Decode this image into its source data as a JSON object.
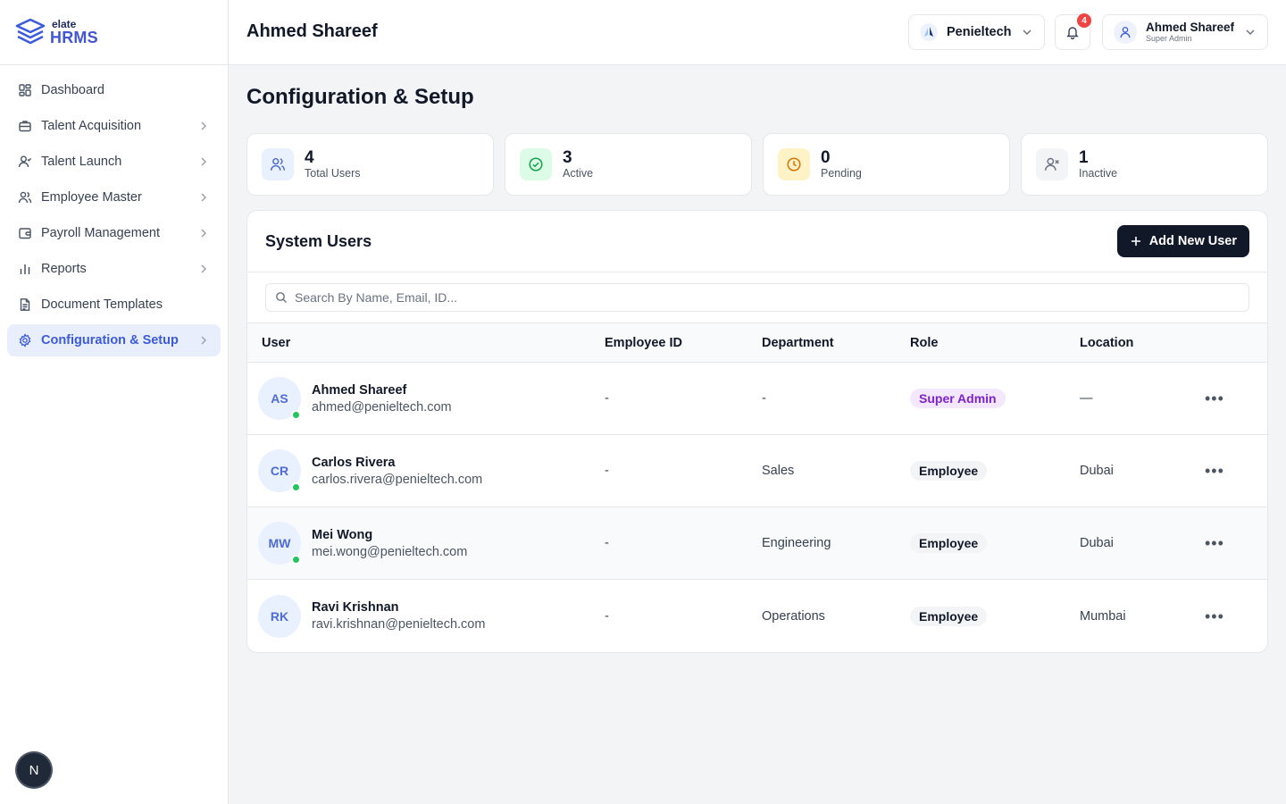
{
  "brand": {
    "small": "elate",
    "big": "HRMS"
  },
  "sidebar": {
    "items": [
      {
        "label": "Dashboard"
      },
      {
        "label": "Talent Acquisition"
      },
      {
        "label": "Talent Launch"
      },
      {
        "label": "Employee Master"
      },
      {
        "label": "Payroll Management"
      },
      {
        "label": "Reports"
      },
      {
        "label": "Document Templates"
      },
      {
        "label": "Configuration & Setup"
      }
    ],
    "bottom_badge": "N"
  },
  "header": {
    "title": "Ahmed Shareef",
    "org": "Penieltech",
    "notifications": "4",
    "user_name": "Ahmed Shareef",
    "user_role": "Super Admin"
  },
  "main": {
    "title": "Configuration & Setup",
    "stats": [
      {
        "value": "4",
        "label": "Total Users"
      },
      {
        "value": "3",
        "label": "Active"
      },
      {
        "value": "0",
        "label": "Pending"
      },
      {
        "value": "1",
        "label": "Inactive"
      }
    ],
    "card": {
      "title": "System Users",
      "add_button": "Add New User",
      "search_placeholder": "Search By Name, Email, ID..."
    },
    "table": {
      "headers": [
        "User",
        "Employee ID",
        "Department",
        "Role",
        "Location"
      ],
      "rows": [
        {
          "initials": "AS",
          "name": "Ahmed Shareef",
          "email": "ahmed@penieltech.com",
          "employee_id": "-",
          "department": "-",
          "role": "Super Admin",
          "location": "—"
        },
        {
          "initials": "CR",
          "name": "Carlos Rivera",
          "email": "carlos.rivera@penieltech.com",
          "employee_id": "-",
          "department": "Sales",
          "role": "Employee",
          "location": "Dubai"
        },
        {
          "initials": "MW",
          "name": "Mei Wong",
          "email": "mei.wong@penieltech.com",
          "employee_id": "-",
          "department": "Engineering",
          "role": "Employee",
          "location": "Dubai"
        },
        {
          "initials": "RK",
          "name": "Ravi Krishnan",
          "email": "ravi.krishnan@penieltech.com",
          "employee_id": "-",
          "department": "Operations",
          "role": "Employee",
          "location": "Mumbai"
        }
      ]
    }
  },
  "colors": {
    "accent": "#3b5bdb",
    "active_bg": "#e8eefc",
    "online": "#22c55e",
    "super_admin_bg": "#f3e8ff",
    "super_admin_text": "#7e22ce"
  }
}
